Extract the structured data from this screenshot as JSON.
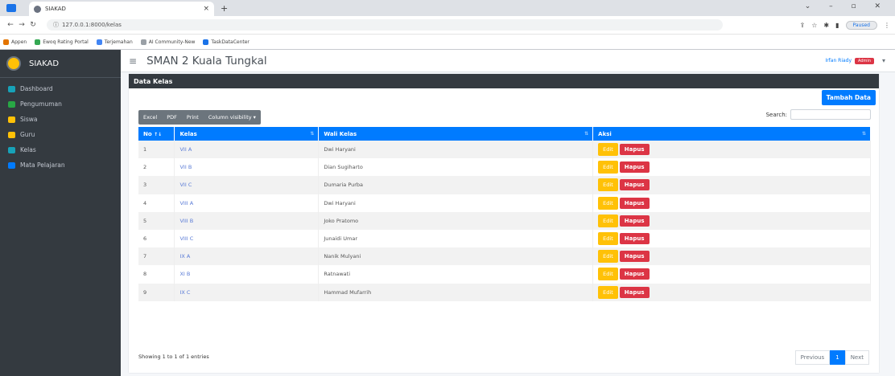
{
  "browser": {
    "tab_title": "SIAKAD",
    "url": "127.0.0.1:8000/kelas",
    "paused_label": "Paused",
    "bookmarks": [
      {
        "label": "Appen",
        "color": "#e37400"
      },
      {
        "label": "Ewoq Rating Portal",
        "color": "#34a853"
      },
      {
        "label": "Terjemahan",
        "color": "#4285f4"
      },
      {
        "label": "AI Community-New",
        "color": "#9aa0a6"
      },
      {
        "label": "TaskDataCenter",
        "color": "#1a73e8"
      }
    ]
  },
  "sidebar": {
    "brand": "SIAKAD",
    "items": [
      {
        "label": "Dashboard",
        "icon": "dashboard-icon",
        "color": "#17a2b8"
      },
      {
        "label": "Pengumuman",
        "icon": "announcement-icon",
        "color": "#28a745"
      },
      {
        "label": "Siswa",
        "icon": "students-icon",
        "color": "#ffc107"
      },
      {
        "label": "Guru",
        "icon": "teachers-icon",
        "color": "#ffc107"
      },
      {
        "label": "Kelas",
        "icon": "class-icon",
        "color": "#17a2b8"
      },
      {
        "label": "Mata Pelajaran",
        "icon": "subjects-icon",
        "color": "#007bff"
      }
    ]
  },
  "header": {
    "school_name": "SMAN 2 Kuala Tungkal",
    "user_name": "Irfan Riady",
    "role_badge": "Admin"
  },
  "card": {
    "title": "Data Kelas",
    "add_button": "Tambah Data",
    "export_buttons": [
      "Excel",
      "PDF",
      "Print",
      "Column visibility ▾"
    ],
    "search_label": "Search:",
    "columns": [
      "No",
      "Kelas",
      "Wali Kelas",
      "Aksi"
    ],
    "rows": [
      {
        "no": "1",
        "kelas": "VII A",
        "wali": "Dwi Haryani"
      },
      {
        "no": "2",
        "kelas": "VII B",
        "wali": "Dian Sugiharto"
      },
      {
        "no": "3",
        "kelas": "VII C",
        "wali": "Dumaria Purba"
      },
      {
        "no": "4",
        "kelas": "VIII A",
        "wali": "Dwi Haryani"
      },
      {
        "no": "5",
        "kelas": "VIII B",
        "wali": "Joko Pratomo"
      },
      {
        "no": "6",
        "kelas": "VIII C",
        "wali": "Junaidi Umar"
      },
      {
        "no": "7",
        "kelas": "IX A",
        "wali": "Nanik Mulyani"
      },
      {
        "no": "8",
        "kelas": "XI B",
        "wali": "Ratnawati"
      },
      {
        "no": "9",
        "kelas": "IX C",
        "wali": "Hammad Mufarrih"
      }
    ],
    "edit_label": "Edit",
    "delete_label": "Hapus",
    "info": "Showing 1 to 1 of 1 entries",
    "pagination": {
      "previous": "Previous",
      "current": "1",
      "next": "Next"
    }
  },
  "colors": {
    "primary": "#007bff",
    "danger": "#dc3545",
    "warning": "#ffc107",
    "dark": "#343a40"
  }
}
